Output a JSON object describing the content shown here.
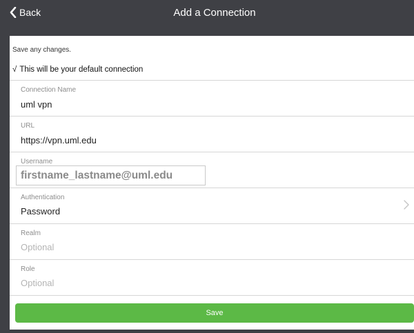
{
  "nav": {
    "back_label": "Back",
    "title": "Add a Connection"
  },
  "notes": {
    "save_hint": "Save any changes.",
    "default_check": "√",
    "default_text": "This will be your default connection"
  },
  "fields": {
    "connection_name": {
      "label": "Connection Name",
      "value": "uml vpn"
    },
    "url": {
      "label": "URL",
      "value": "https://vpn.uml.edu"
    },
    "username": {
      "label": "Username",
      "value": "firstname_lastname@uml.edu"
    },
    "authentication": {
      "label": "Authentication",
      "value": "Password"
    },
    "realm": {
      "label": "Realm",
      "placeholder": "Optional"
    },
    "role": {
      "label": "Role",
      "placeholder": "Optional"
    }
  },
  "actions": {
    "save_label": "Save"
  },
  "icons": {
    "back": "chevron-left-icon",
    "disclosure": "chevron-right-icon"
  },
  "colors": {
    "navbar": "#3f4045",
    "save_button": "#5cb946",
    "divider": "#d6d6d6"
  }
}
